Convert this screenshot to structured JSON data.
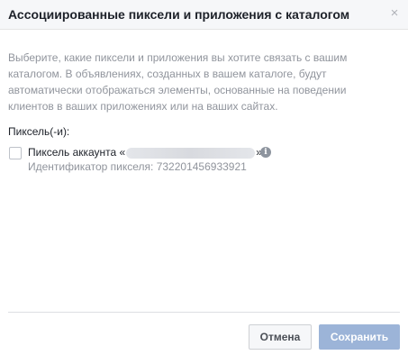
{
  "dialog": {
    "title": "Ассоциированные пиксели и приложения с каталогом",
    "close_glyph": "×",
    "description": "Выберите, какие пиксели и приложения вы хотите связать с вашим каталогом. В объявлениях, созданных в вашем каталоге, будут автоматически отображаться элементы, основанные на поведении клиентов в ваших приложениях или на ваших сайтах.",
    "section_label": "Пиксель(-и):",
    "pixel": {
      "name_prefix": "Пиксель аккаунта «",
      "name_suffix": "»",
      "id_text": "Идентификатор пикселя: 732201456933921",
      "checked": false,
      "info_glyph": "i"
    },
    "buttons": {
      "cancel_label": "Отмена",
      "save_label": "Сохранить",
      "save_enabled": false
    }
  },
  "colors": {
    "header_bg": "#f6f7f9",
    "secondary_text": "#90949c",
    "primary_disabled": "#9cb4d8"
  }
}
